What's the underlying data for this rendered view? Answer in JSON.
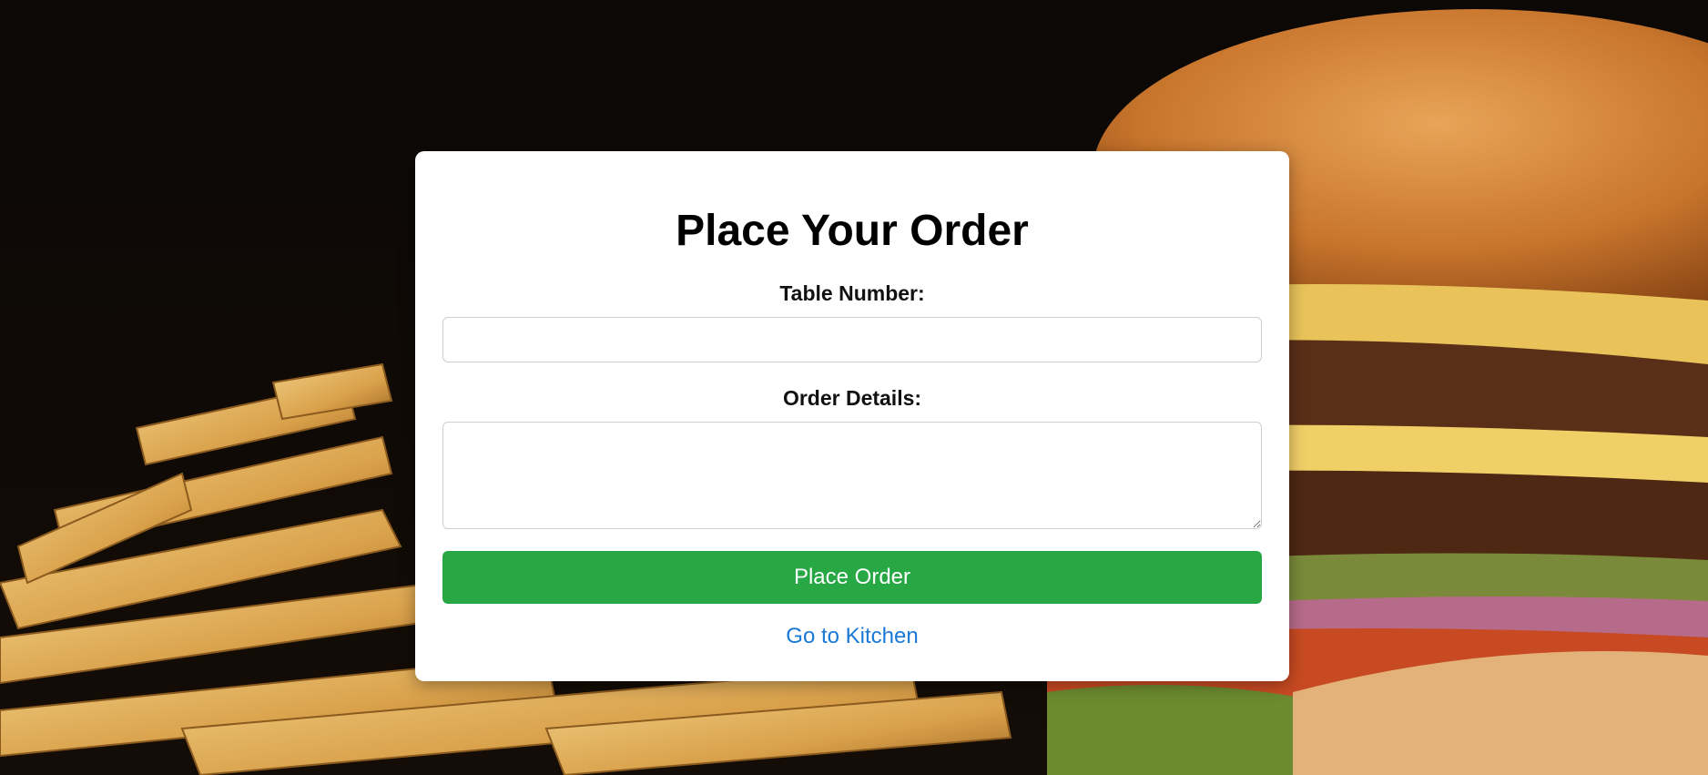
{
  "page": {
    "title": "Place Your Order"
  },
  "form": {
    "table_label": "Table Number:",
    "table_value": "",
    "details_label": "Order Details:",
    "details_value": "",
    "submit_label": "Place Order"
  },
  "nav": {
    "kitchen_link": "Go to Kitchen"
  },
  "colors": {
    "submit_bg": "#28a745",
    "link": "#1a78d6",
    "card_bg": "#ffffff"
  }
}
